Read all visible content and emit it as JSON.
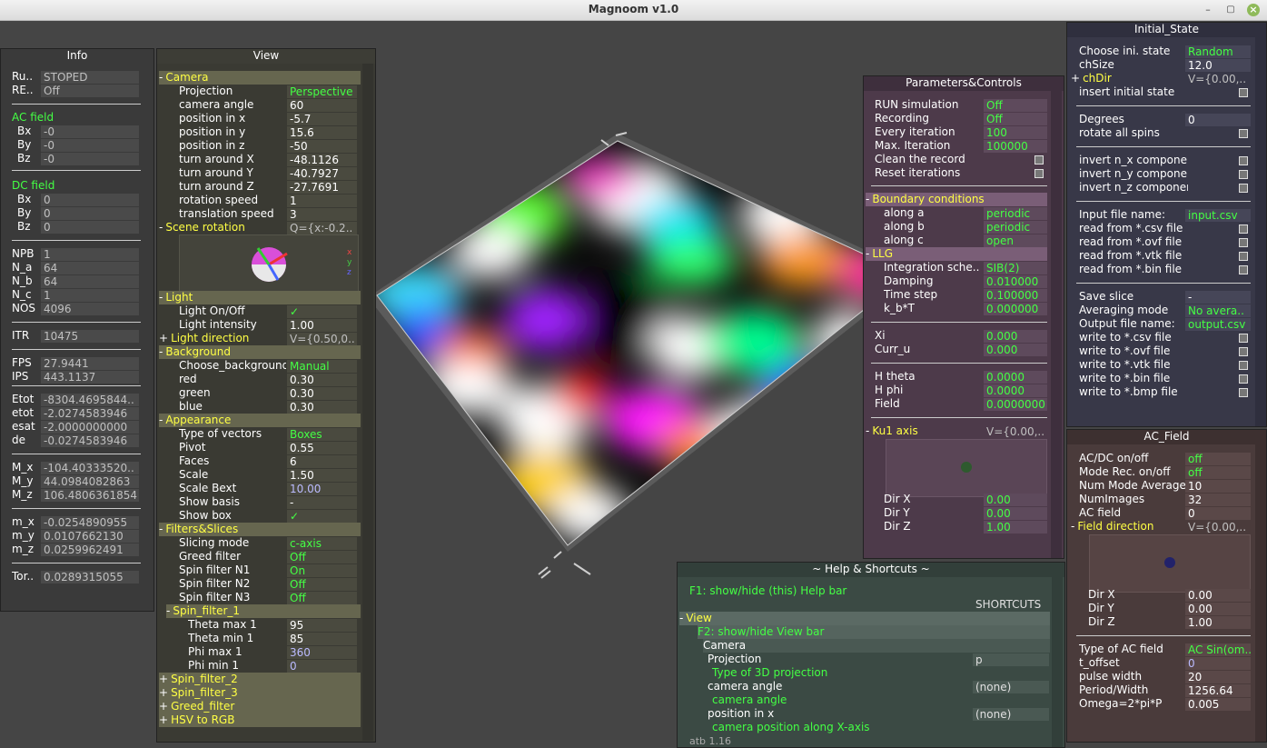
{
  "window": {
    "title": "Magnoom v1.0"
  },
  "info": {
    "title": "Info",
    "rows": [
      {
        "k": "Ru..",
        "v": "STOPED"
      },
      {
        "k": "RE..",
        "v": "Off"
      },
      {
        "g": "AC field"
      },
      {
        "k": "Bx",
        "v": "-0"
      },
      {
        "k": "By",
        "v": "-0"
      },
      {
        "k": "Bz",
        "v": "-0"
      },
      {
        "g": "DC field"
      },
      {
        "k": "Bx",
        "v": "0"
      },
      {
        "k": "By",
        "v": "0"
      },
      {
        "k": "Bz",
        "v": "0"
      },
      {
        "k": "NPB",
        "v": "1"
      },
      {
        "k": "N_a",
        "v": "64"
      },
      {
        "k": "N_b",
        "v": "64"
      },
      {
        "k": "N_c",
        "v": "1"
      },
      {
        "k": "NOS",
        "v": "4096"
      },
      {
        "k": "ITR",
        "v": "10475"
      },
      {
        "k": "FPS",
        "v": "27.9441"
      },
      {
        "k": "IPS",
        "v": "443.1137"
      },
      {
        "k": "Etot",
        "v": "-8304.4695844.."
      },
      {
        "k": "etot",
        "v": "-2.0274583946"
      },
      {
        "k": "esat",
        "v": "-2.0000000000"
      },
      {
        "k": "de",
        "v": "-0.0274583946"
      },
      {
        "k": "M_x",
        "v": "-104.40333520.."
      },
      {
        "k": "M_y",
        "v": "44.0984082863"
      },
      {
        "k": "M_z",
        "v": "106.4806361854"
      },
      {
        "k": "m_x",
        "v": "-0.0254890955"
      },
      {
        "k": "m_y",
        "v": "0.0107662130"
      },
      {
        "k": "m_z",
        "v": "0.0259962491"
      },
      {
        "k": "Tor..",
        "v": "0.0289315055"
      }
    ]
  },
  "view": {
    "title": "View",
    "groups": [
      {
        "name": "Camera",
        "items": [
          [
            "Projection",
            "Perspective"
          ],
          [
            "camera angle",
            "60"
          ],
          [
            "position in x",
            "-5.7"
          ],
          [
            "position in y",
            "15.6"
          ],
          [
            "position in z",
            "-50"
          ],
          [
            "turn around X",
            "-48.1126"
          ],
          [
            "turn around Y",
            "-40.7927"
          ],
          [
            "turn around Z",
            "-27.7691"
          ],
          [
            "rotation speed",
            "1"
          ],
          [
            "translation speed",
            "3"
          ]
        ]
      },
      {
        "name": "Scene rotation",
        "value": "Q={x:-0.2.."
      },
      {
        "name": "Light",
        "items": [
          [
            "Light On/Off",
            "✓"
          ],
          [
            "Light intensity",
            "1.00"
          ]
        ]
      },
      {
        "name": "Light direction",
        "value": "V={0.50,0.."
      },
      {
        "name": "Background",
        "items": [
          [
            "Choose_background",
            "Manual"
          ],
          [
            "red",
            "0.30"
          ],
          [
            "green",
            "0.30"
          ],
          [
            "blue",
            "0.30"
          ]
        ]
      },
      {
        "name": "Appearance",
        "items": [
          [
            "Type of vectors",
            "Boxes"
          ],
          [
            "Pivot",
            "0.55"
          ],
          [
            "Faces",
            "6"
          ],
          [
            "Scale",
            "1.50"
          ],
          [
            "Scale Bext",
            "10.00"
          ],
          [
            "Show basis",
            "-"
          ],
          [
            "Show box",
            "✓"
          ]
        ]
      },
      {
        "name": "Filters&Slices",
        "items": [
          [
            "Slicing mode",
            "c-axis"
          ],
          [
            "Greed filter",
            "Off"
          ],
          [
            "Spin filter N1",
            "On"
          ],
          [
            "Spin filter N2",
            "Off"
          ],
          [
            "Spin filter N3",
            "Off"
          ]
        ]
      },
      {
        "name": "Spin_filter_1",
        "items": [
          [
            "Theta max 1",
            "95"
          ],
          [
            "Theta min 1",
            "85"
          ],
          [
            "Phi max 1",
            "360"
          ],
          [
            "Phi min 1",
            "0"
          ]
        ]
      },
      {
        "name": "Spin_filter_2"
      },
      {
        "name": "Spin_filter_3"
      },
      {
        "name": "Greed_filter"
      },
      {
        "name": "HSV to RGB"
      }
    ],
    "axes": [
      "x",
      "y",
      "z"
    ]
  },
  "params": {
    "title": "Parameters&Controls",
    "top": [
      [
        "RUN simulation",
        "Off"
      ],
      [
        "Recording",
        "Off"
      ],
      [
        "Every iteration",
        "100"
      ],
      [
        "Max. Iteration",
        "100000"
      ],
      [
        "Clean the record",
        ""
      ],
      [
        "Reset iterations",
        ""
      ]
    ],
    "boundary": {
      "name": "Boundary conditions",
      "items": [
        [
          "along a",
          "periodic"
        ],
        [
          "along b",
          "periodic"
        ],
        [
          "along c",
          "open"
        ]
      ]
    },
    "llg": {
      "name": "LLG",
      "items": [
        [
          "Integration sche..",
          "SIB(2)"
        ],
        [
          "Damping",
          "0.010000"
        ],
        [
          "Time step",
          "0.100000"
        ],
        [
          "k_b*T",
          "0.000000"
        ]
      ]
    },
    "mid": [
      [
        "Xi",
        "0.000"
      ],
      [
        "Curr_u",
        "0.000"
      ]
    ],
    "field": [
      [
        "H theta",
        "0.0000"
      ],
      [
        "H phi",
        "0.0000"
      ],
      [
        "Field",
        "0.0000000"
      ]
    ],
    "ku1": {
      "name": "Ku1 axis",
      "value": "V={0.00,.."
    },
    "dirs": [
      [
        "Dir X",
        "0.00"
      ],
      [
        "Dir Y",
        "0.00"
      ],
      [
        "Dir Z",
        "1.00"
      ]
    ]
  },
  "initial": {
    "title": "Initial_State",
    "rows": [
      [
        "Choose ini. state",
        "Random"
      ],
      [
        "chSize",
        "12.0"
      ],
      [
        "chDir",
        "V={0.00,.."
      ],
      [
        "insert initial state",
        ""
      ]
    ],
    "rows2": [
      [
        "Degrees",
        "0"
      ],
      [
        "rotate all spins",
        ""
      ]
    ],
    "rows3": [
      [
        "invert n_x component",
        ""
      ],
      [
        "invert n_y component",
        ""
      ],
      [
        "invert n_z component",
        ""
      ]
    ],
    "rows4": [
      [
        "Input file name:",
        "input.csv"
      ],
      [
        "read from *.csv file",
        ""
      ],
      [
        "read from *.ovf file",
        ""
      ],
      [
        "read from *.vtk file",
        ""
      ],
      [
        "read from *.bin file",
        ""
      ]
    ],
    "rows5": [
      [
        "Save slice",
        "-"
      ],
      [
        "Averaging mode",
        "No avera.."
      ],
      [
        "Output file name:",
        "output.csv"
      ],
      [
        "write to *.csv file",
        ""
      ],
      [
        "write to *.ovf file",
        ""
      ],
      [
        "write to *.vtk file",
        ""
      ],
      [
        "write to *.bin file",
        ""
      ],
      [
        "write to *.bmp file",
        ""
      ]
    ]
  },
  "ac": {
    "title": "AC_Field",
    "rows": [
      [
        "AC/DC on/off",
        "off"
      ],
      [
        "Mode Rec. on/off",
        "off"
      ],
      [
        "Num Mode Average",
        "10"
      ],
      [
        "NumImages",
        "32"
      ],
      [
        "AC field",
        "0"
      ]
    ],
    "fdir": {
      "name": "Field direction",
      "value": "V={0.00,.."
    },
    "dirs": [
      [
        "Dir X",
        "0.00"
      ],
      [
        "Dir Y",
        "0.00"
      ],
      [
        "Dir Z",
        "1.00"
      ]
    ],
    "rows2": [
      [
        "Type of AC field",
        "AC Sin(om.."
      ],
      [
        "t_offset",
        "0"
      ],
      [
        "pulse width",
        "20"
      ],
      [
        "Period/Width",
        "1256.64"
      ],
      [
        "Omega=2*pi*P",
        "0.005"
      ]
    ]
  },
  "help": {
    "title": "~ Help & Shortcuts ~",
    "line1": "F1: show/hide (this) Help bar",
    "shortcuts": "SHORTCUTS",
    "view": "View",
    "f2": "F2: show/hide View bar",
    "camera": "Camera",
    "items": [
      {
        "k": "Projection",
        "s": "p",
        "d": "Type of 3D projection"
      },
      {
        "k": "camera angle",
        "s": "(none)",
        "d": "camera angle"
      },
      {
        "k": "position in x",
        "s": "(none)",
        "d": "camera position along X-axis"
      }
    ],
    "footer": "atb  1.16"
  }
}
